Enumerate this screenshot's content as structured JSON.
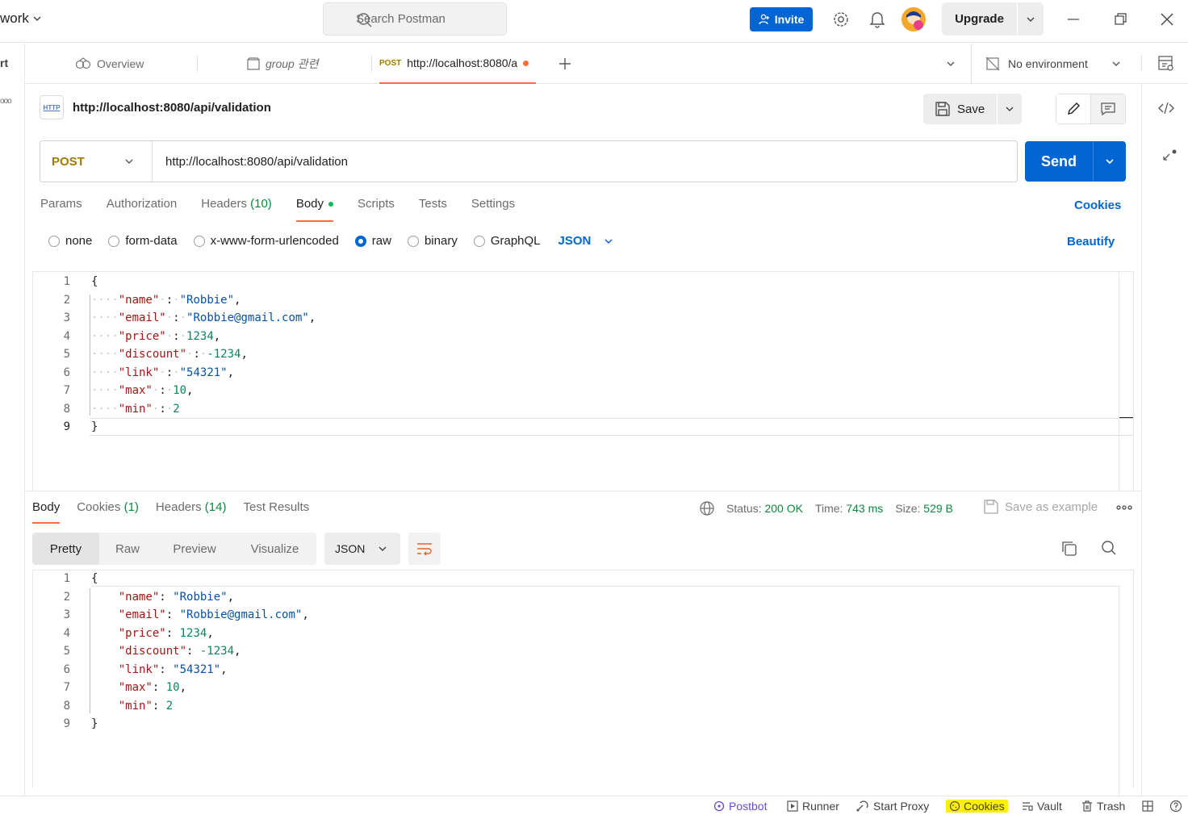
{
  "topbar": {
    "workspace": "work",
    "search_placeholder": "Search Postman",
    "invite": "Invite",
    "upgrade": "Upgrade"
  },
  "left_rail": {
    "label": "rt",
    "more": "ooo"
  },
  "tabs": {
    "overview": "Overview",
    "group": "group 관련",
    "request_method": "POST",
    "request_label": "http://localhost:8080/a"
  },
  "environment": {
    "selected": "No environment"
  },
  "request": {
    "title": "http://localhost:8080/api/validation",
    "badge": "HTTP",
    "save": "Save",
    "method": "POST",
    "url": "http://localhost:8080/api/validation",
    "send": "Send"
  },
  "request_tabs": {
    "params": "Params",
    "authorization": "Authorization",
    "headers": "Headers",
    "headers_count": "(10)",
    "body": "Body",
    "scripts": "Scripts",
    "tests": "Tests",
    "settings": "Settings",
    "cookies": "Cookies"
  },
  "body_types": {
    "options": [
      "none",
      "form-data",
      "x-www-form-urlencoded",
      "raw",
      "binary",
      "GraphQL"
    ],
    "selected": "raw",
    "format": "JSON",
    "beautify": "Beautify"
  },
  "request_body_lines": [
    "{",
    "····\"name\"·:·\"Robbie\",",
    "····\"email\"·:·\"Robbie@gmail.com\",",
    "····\"price\"·:·1234,",
    "····\"discount\"·:·-1234,",
    "····\"link\"·:·\"54321\",",
    "····\"max\"·:·10,",
    "····\"min\"·:·2",
    "}"
  ],
  "response_tabs": {
    "body": "Body",
    "cookies": "Cookies",
    "cookies_count": "(1)",
    "headers": "Headers",
    "headers_count": "(14)",
    "test_results": "Test Results"
  },
  "response_meta": {
    "status_label": "Status:",
    "status_value": "200 OK",
    "time_label": "Time:",
    "time_value": "743 ms",
    "size_label": "Size:",
    "size_value": "529 B",
    "save_example": "Save as example"
  },
  "response_view": {
    "modes": [
      "Pretty",
      "Raw",
      "Preview",
      "Visualize"
    ],
    "selected": "Pretty",
    "format": "JSON"
  },
  "response_body_lines": [
    "{",
    "    \"name\": \"Robbie\",",
    "    \"email\": \"Robbie@gmail.com\",",
    "    \"price\": 1234,",
    "    \"discount\": -1234,",
    "    \"link\": \"54321\",",
    "    \"max\": 10,",
    "    \"min\": 2",
    "}"
  ],
  "status_bar": {
    "postbot": "Postbot",
    "runner": "Runner",
    "start_proxy": "Start Proxy",
    "cookies": "Cookies",
    "vault": "Vault",
    "trash": "Trash"
  },
  "colors": {
    "accent": "#0265d2",
    "tab_indicator": "#ff6c37",
    "success": "#0a8a3a",
    "method_post": "#a07a00",
    "json_key": "#a31515",
    "json_string": "#0451a5",
    "json_number": "#098658",
    "highlight": "#ffef00"
  }
}
